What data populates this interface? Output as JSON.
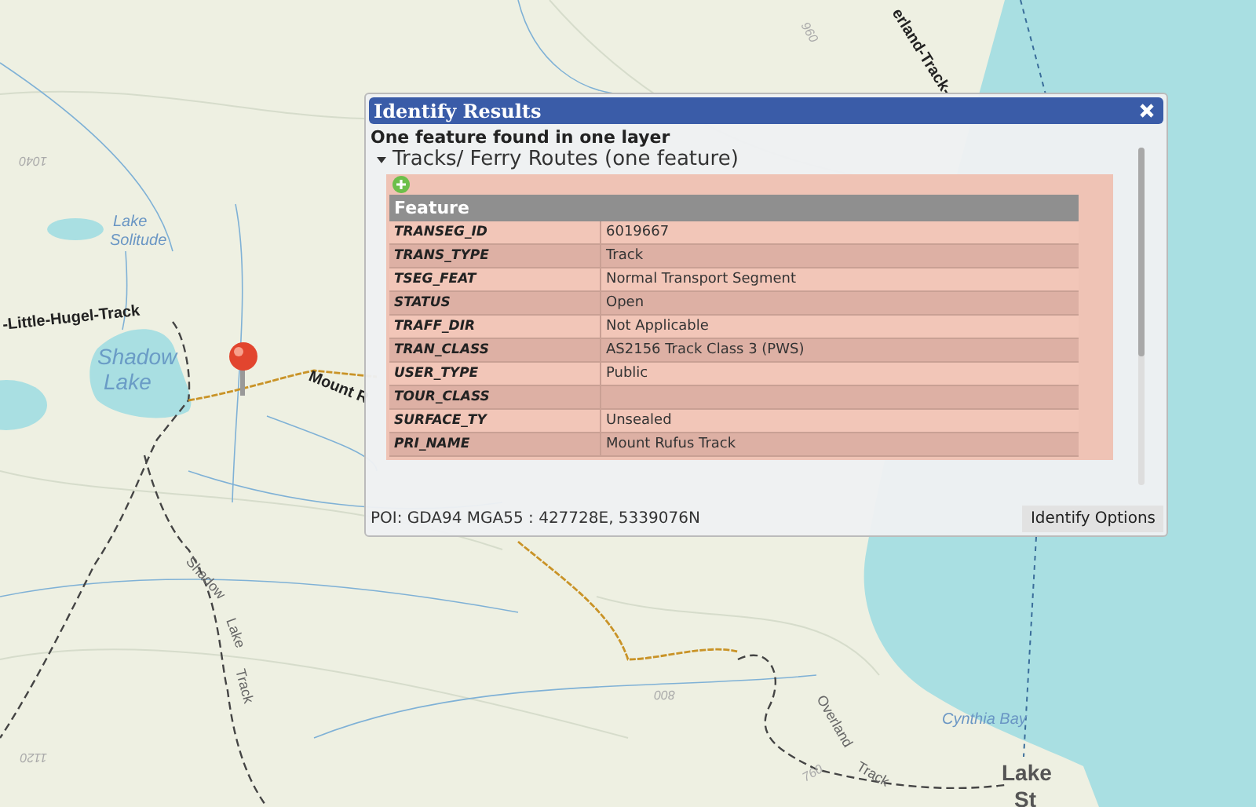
{
  "map": {
    "labels": [
      {
        "kind": "water",
        "text": "Lake"
      },
      {
        "kind": "water",
        "text": "Solitude"
      },
      {
        "kind": "track",
        "text": "-Little-Hugel-Track"
      },
      {
        "kind": "lake",
        "text": "Shadow"
      },
      {
        "kind": "lake",
        "text": "Lake"
      },
      {
        "kind": "track",
        "text": "Mount R"
      },
      {
        "kind": "track-small",
        "text": "Shadow"
      },
      {
        "kind": "track-small",
        "text": "Lake"
      },
      {
        "kind": "track-small",
        "text": "Track"
      },
      {
        "kind": "track",
        "text": "erland-Track-"
      },
      {
        "kind": "track-small",
        "text": "Overland"
      },
      {
        "kind": "track-small",
        "text": "Track"
      },
      {
        "kind": "water",
        "text": "Cynthia Bay"
      },
      {
        "kind": "town",
        "text": "Lake"
      },
      {
        "kind": "town",
        "text": "St"
      },
      {
        "kind": "contour",
        "text": "1040"
      },
      {
        "kind": "contour",
        "text": "1120"
      },
      {
        "kind": "contour",
        "text": "960"
      },
      {
        "kind": "contour",
        "text": "800"
      },
      {
        "kind": "contour",
        "text": "760"
      }
    ]
  },
  "dialog": {
    "title": "Identify Results",
    "summary": "One feature found in one layer",
    "layer": {
      "name": "Tracks/ Ferry Routes (one feature)",
      "expanded": true,
      "table": {
        "heading": "Feature",
        "rows": [
          {
            "field": "TRANSEG_ID",
            "value": "6019667"
          },
          {
            "field": "TRANS_TYPE",
            "value": "Track"
          },
          {
            "field": "TSEG_FEAT",
            "value": "Normal Transport Segment"
          },
          {
            "field": "STATUS",
            "value": "Open"
          },
          {
            "field": "TRAFF_DIR",
            "value": "Not Applicable"
          },
          {
            "field": "TRAN_CLASS",
            "value": "AS2156 Track Class 3 (PWS)"
          },
          {
            "field": "USER_TYPE",
            "value": "Public"
          },
          {
            "field": "TOUR_CLASS"
          },
          {
            "field": "SURFACE_TY",
            "value": "Unsealed"
          },
          {
            "field": "PRI_NAME",
            "value": "Mount Rufus Track"
          }
        ]
      }
    },
    "poi": "POI: GDA94 MGA55 : 427728E, 5339076N",
    "options_button": "Identify Options"
  }
}
